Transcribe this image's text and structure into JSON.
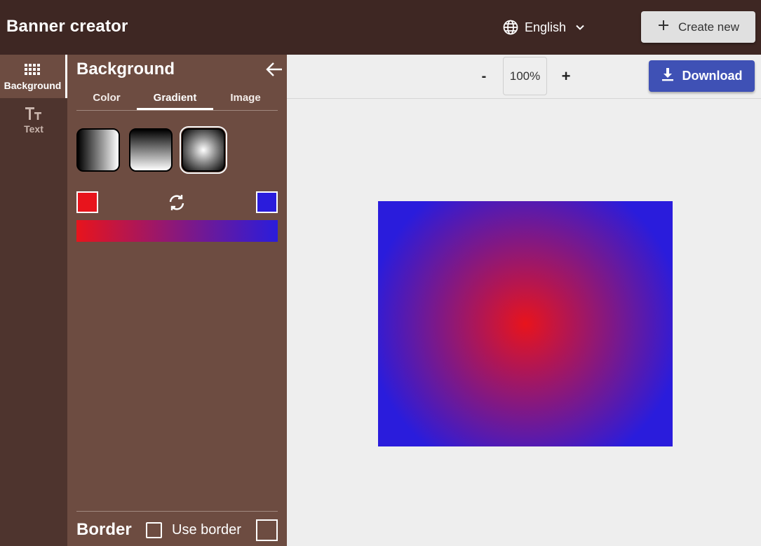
{
  "header": {
    "title": "Banner creator",
    "language": {
      "label": "English",
      "icon": "globe-icon"
    },
    "create_new_label": "Create new"
  },
  "rail": {
    "items": [
      {
        "label": "Background",
        "icon": "grid-icon",
        "active": true
      },
      {
        "label": "Text",
        "icon": "text-size-icon",
        "active": false
      }
    ]
  },
  "panel": {
    "title": "Background",
    "tabs": [
      {
        "label": "Color",
        "active": false
      },
      {
        "label": "Gradient",
        "active": true
      },
      {
        "label": "Image",
        "active": false
      }
    ],
    "gradient_presets": [
      {
        "type": "linear-horizontal",
        "selected": false
      },
      {
        "type": "linear-vertical",
        "selected": false
      },
      {
        "type": "radial",
        "selected": true
      }
    ],
    "start_color": "#e8141c",
    "end_color": "#2a1cdc",
    "border": {
      "title": "Border",
      "use_border_label": "Use border",
      "use_border_checked": false
    }
  },
  "toolbar": {
    "zoom_out_label": "-",
    "zoom_value": "100%",
    "zoom_in_label": "+",
    "download_label": "Download"
  },
  "colors": {
    "header_bg": "#3e2723",
    "rail_bg": "#4e342e",
    "panel_bg": "#6d4c41",
    "accent": "#3f51b5"
  }
}
